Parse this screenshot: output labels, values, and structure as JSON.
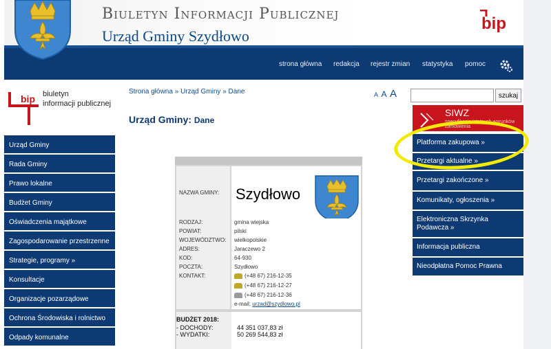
{
  "header": {
    "title": "Biuletyn Informacji Publicznej",
    "subtitle": "Urząd Gminy Szydłowo",
    "logo_text": "bip"
  },
  "topnav": {
    "items": [
      "strona główna",
      "redakcja",
      "rejestr zmian",
      "statystyka",
      "pomoc"
    ]
  },
  "bip_badge": {
    "logo_text": "bip",
    "line1": "biuletyn",
    "line2": "informacji publicznej"
  },
  "breadcrumb": [
    "Strona główna",
    "»",
    "Urząd Gminy",
    "»",
    "Dane"
  ],
  "font_size_controls": [
    "A",
    "A",
    "A"
  ],
  "page_title": {
    "main": "Urząd Gminy:",
    "sub": "Dane"
  },
  "left_menu": [
    "Urząd Gminy",
    "Rada Gminy",
    "Prawo lokalne",
    "Budżet Gminy",
    "Oświadczenia majątkowe",
    "Zagospodarowanie przestrzenne",
    "Strategie, programy »",
    "Konsultacje",
    "Organizacje pozarządowe",
    "Ochrona Środowiska i rolnictwo",
    "Odpady komunalne"
  ],
  "info": {
    "name_label": "NAZWA GMINY:",
    "name_value": "Szydłowo",
    "rows": [
      {
        "label": "RODZAJ:",
        "value": "gmina wiejska"
      },
      {
        "label": "POWIAT:",
        "value": "pilski"
      },
      {
        "label": "WOJEWÓDZTWO:",
        "value": "wielkopolskie"
      },
      {
        "label": "ADRES:",
        "value": "Jaraczewo 2"
      },
      {
        "label": "KOD:",
        "value": "64-930"
      },
      {
        "label": "POCZTA:",
        "value": "Szydłowo"
      },
      {
        "label": "KONTAKT:",
        "value": "(+48 67) 216-12-35"
      }
    ],
    "phone2": "(+48 67) 216-12-27",
    "fax": "(+48 67) 216-12-36",
    "email_label": "e-mail:",
    "email": "urzad@szydlowo.pl",
    "budget_title": "BUDŻET 2018:",
    "income_label": "- DOCHODY:",
    "income_value": "44 351 037,83 zł",
    "expense_label": "- WYDATKI:",
    "expense_value": "50 269 544,83 zł"
  },
  "search": {
    "placeholder": "",
    "button": "szukaj"
  },
  "siwz": {
    "title": "SIWZ",
    "desc": "specyfikacja istotnych warunków zamówienia"
  },
  "right_menu": [
    "Platforma zakupowa »",
    "Przetargi aktualne »",
    "Przetargi zakończone »",
    "Komunikaty, ogłoszenia »",
    "Elektroniczna Skrzynka Podawcza »",
    "Informacja publiczna",
    "Nieodpłatna Pomoc Prawna"
  ],
  "colors": {
    "navy": "#0e3a73",
    "bip_red": "#c8141c",
    "highlight": "#f2ea00"
  }
}
